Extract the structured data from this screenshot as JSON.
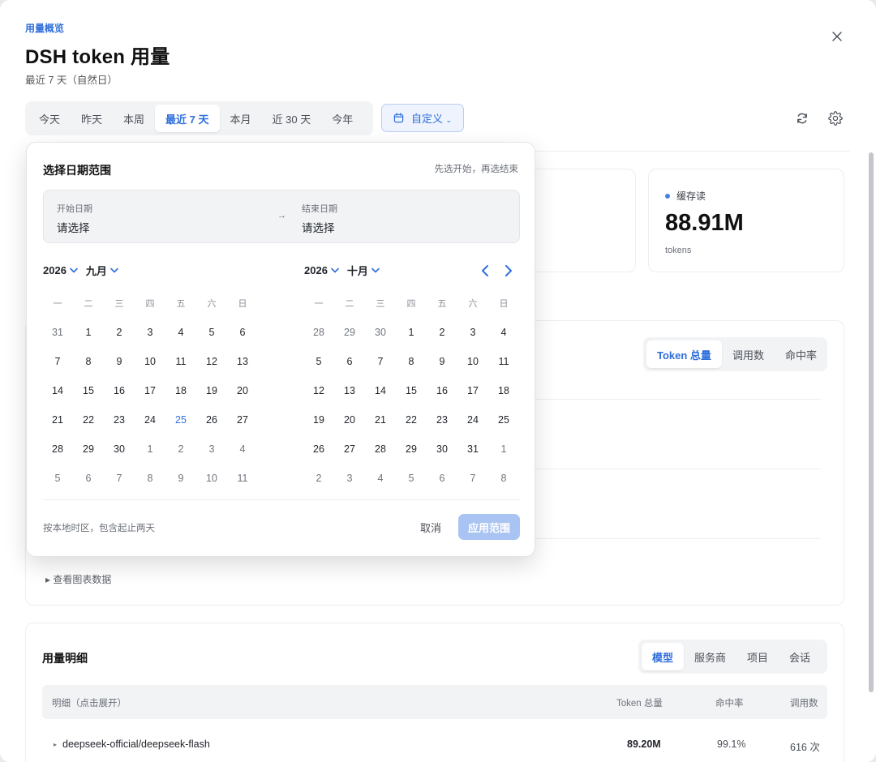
{
  "header": {
    "eyebrow": "用量概览",
    "title": "DSH token 用量",
    "subtitle": "最近 7 天（自然日）"
  },
  "range_tabs": [
    {
      "label": "今天",
      "active": false
    },
    {
      "label": "昨天",
      "active": false
    },
    {
      "label": "本周",
      "active": false
    },
    {
      "label": "最近 7 天",
      "active": true
    },
    {
      "label": "本月",
      "active": false
    },
    {
      "label": "近 30 天",
      "active": false
    },
    {
      "label": "今年",
      "active": false
    }
  ],
  "custom_button": {
    "label": "自定义",
    "icon": "calendar-icon",
    "chevron": "⌄"
  },
  "toolbar_icons": [
    "refresh-icon",
    "gear-icon"
  ],
  "stat_card": {
    "label": "缓存读",
    "value": "88.91M",
    "unit": "tokens"
  },
  "chart_tabs": [
    {
      "label": "Token 总量",
      "active": true
    },
    {
      "label": "调用数",
      "active": false
    },
    {
      "label": "命中率",
      "active": false
    }
  ],
  "chart_toggle": "▸ 查看图表数据",
  "detail": {
    "title": "用量明细",
    "tabs": [
      {
        "label": "模型",
        "active": true
      },
      {
        "label": "服务商",
        "active": false
      },
      {
        "label": "项目",
        "active": false
      },
      {
        "label": "会话",
        "active": false
      }
    ],
    "columns": [
      "明细（点击展开）",
      "Token 总量",
      "命中率",
      "调用数"
    ],
    "rows": [
      {
        "name": "deepseek-official/deepseek-flash",
        "tokens": "89.20M",
        "hit_rate": "99.1%",
        "calls": "616 次"
      }
    ]
  },
  "picker": {
    "title": "选择日期范围",
    "hint": "先选开始，再选结束",
    "start_label": "开始日期",
    "start_value": "请选择",
    "arrow": "→",
    "end_label": "结束日期",
    "end_value": "请选择",
    "weekdays": [
      "一",
      "二",
      "三",
      "四",
      "五",
      "六",
      "日"
    ],
    "months": [
      {
        "year": "2026",
        "month": "九月",
        "days": [
          {
            "d": "31",
            "m": true
          },
          {
            "d": "1"
          },
          {
            "d": "2"
          },
          {
            "d": "3"
          },
          {
            "d": "4"
          },
          {
            "d": "5"
          },
          {
            "d": "6"
          },
          {
            "d": "7"
          },
          {
            "d": "8"
          },
          {
            "d": "9"
          },
          {
            "d": "10"
          },
          {
            "d": "11"
          },
          {
            "d": "12"
          },
          {
            "d": "13"
          },
          {
            "d": "14"
          },
          {
            "d": "15"
          },
          {
            "d": "16"
          },
          {
            "d": "17"
          },
          {
            "d": "18"
          },
          {
            "d": "19"
          },
          {
            "d": "20"
          },
          {
            "d": "21"
          },
          {
            "d": "22"
          },
          {
            "d": "23"
          },
          {
            "d": "24"
          },
          {
            "d": "25",
            "today": true
          },
          {
            "d": "26"
          },
          {
            "d": "27"
          },
          {
            "d": "28"
          },
          {
            "d": "29"
          },
          {
            "d": "30"
          },
          {
            "d": "1",
            "m": true
          },
          {
            "d": "2",
            "m": true
          },
          {
            "d": "3",
            "m": true
          },
          {
            "d": "4",
            "m": true
          },
          {
            "d": "5",
            "m": true
          },
          {
            "d": "6",
            "m": true
          },
          {
            "d": "7",
            "m": true
          },
          {
            "d": "8",
            "m": true
          },
          {
            "d": "9",
            "m": true
          },
          {
            "d": "10",
            "m": true
          },
          {
            "d": "11",
            "m": true
          }
        ]
      },
      {
        "year": "2026",
        "month": "十月",
        "days": [
          {
            "d": "28",
            "m": true
          },
          {
            "d": "29",
            "m": true
          },
          {
            "d": "30",
            "m": true
          },
          {
            "d": "1"
          },
          {
            "d": "2"
          },
          {
            "d": "3"
          },
          {
            "d": "4"
          },
          {
            "d": "5"
          },
          {
            "d": "6"
          },
          {
            "d": "7"
          },
          {
            "d": "8"
          },
          {
            "d": "9"
          },
          {
            "d": "10"
          },
          {
            "d": "11"
          },
          {
            "d": "12"
          },
          {
            "d": "13"
          },
          {
            "d": "14"
          },
          {
            "d": "15"
          },
          {
            "d": "16"
          },
          {
            "d": "17"
          },
          {
            "d": "18"
          },
          {
            "d": "19"
          },
          {
            "d": "20"
          },
          {
            "d": "21"
          },
          {
            "d": "22"
          },
          {
            "d": "23"
          },
          {
            "d": "24"
          },
          {
            "d": "25"
          },
          {
            "d": "26"
          },
          {
            "d": "27"
          },
          {
            "d": "28"
          },
          {
            "d": "29"
          },
          {
            "d": "30"
          },
          {
            "d": "31"
          },
          {
            "d": "1",
            "m": true
          },
          {
            "d": "2",
            "m": true
          },
          {
            "d": "3",
            "m": true
          },
          {
            "d": "4",
            "m": true
          },
          {
            "d": "5",
            "m": true
          },
          {
            "d": "6",
            "m": true
          },
          {
            "d": "7",
            "m": true
          },
          {
            "d": "8",
            "m": true
          }
        ]
      }
    ],
    "footer_note": "按本地时区，包含起止两天",
    "cancel": "取消",
    "apply": "应用范围"
  },
  "colors": {
    "accent": "#2f6fdb",
    "apply_disabled": "#a9c3f2"
  }
}
